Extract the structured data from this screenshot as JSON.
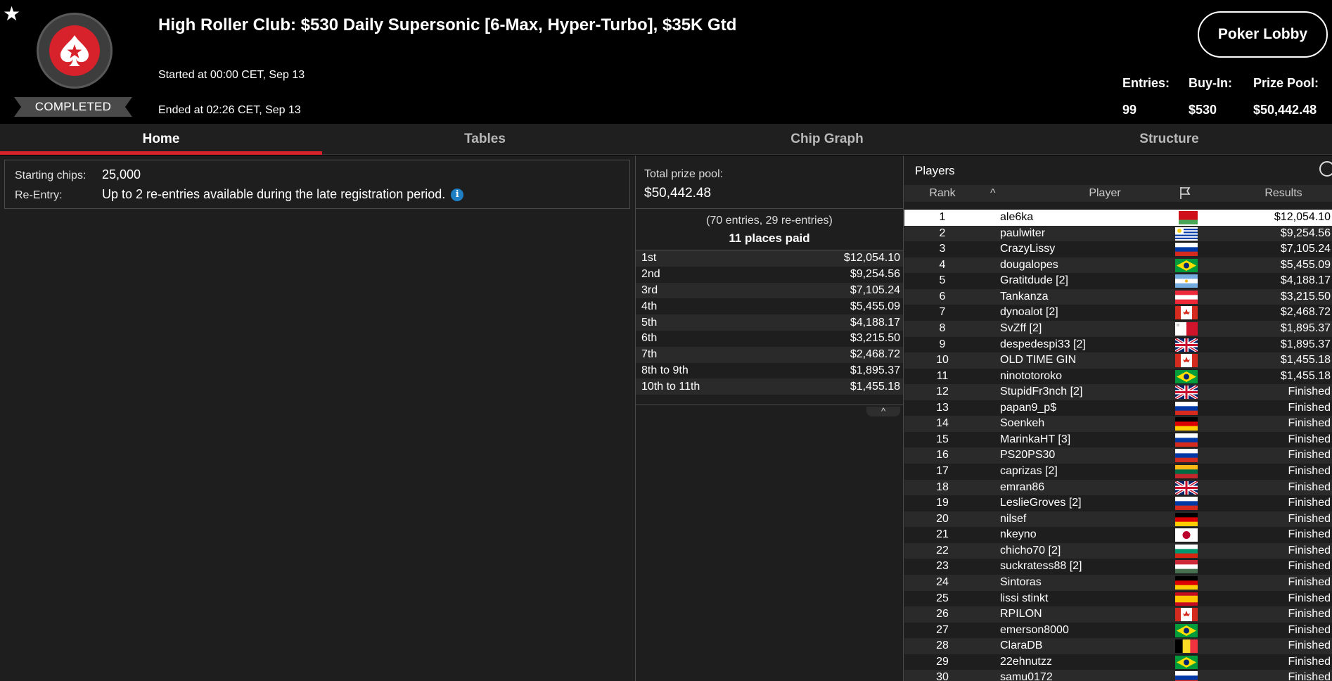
{
  "header": {
    "title": "High Roller Club: $530 Daily Supersonic [6-Max, Hyper-Turbo], $35K Gtd",
    "started": "Started at 00:00 CET, Sep 13",
    "ended": "Ended at 02:26 CET, Sep 13",
    "status": "COMPLETED",
    "lobby_button": "Poker Lobby",
    "stats": {
      "entries_label": "Entries:",
      "entries_value": "99",
      "buyin_label": "Buy-In:",
      "buyin_value": "$530",
      "prizepool_label": "Prize Pool:",
      "prizepool_value": "$50,442.48"
    },
    "icons": {
      "favorite": "star-icon",
      "logo": "pokerstars-spade-logo"
    }
  },
  "tabs": [
    {
      "label": "Home",
      "active": true
    },
    {
      "label": "Tables",
      "active": false
    },
    {
      "label": "Chip Graph",
      "active": false
    },
    {
      "label": "Structure",
      "active": false
    }
  ],
  "info": {
    "starting_chips_label": "Starting chips:",
    "starting_chips_value": "25,000",
    "reentry_label": "Re-Entry:",
    "reentry_value": "Up to 2 re-entries available during the late registration period.",
    "info_icon": "i"
  },
  "prize": {
    "total_label": "Total prize pool:",
    "total_value": "$50,442.48",
    "entries_note": "(70 entries, 29 re-entries)",
    "places_paid": "11 places paid",
    "payouts": [
      {
        "place": "1st",
        "amount": "$12,054.10"
      },
      {
        "place": "2nd",
        "amount": "$9,254.56"
      },
      {
        "place": "3rd",
        "amount": "$7,105.24"
      },
      {
        "place": "4th",
        "amount": "$5,455.09"
      },
      {
        "place": "5th",
        "amount": "$4,188.17"
      },
      {
        "place": "6th",
        "amount": "$3,215.50"
      },
      {
        "place": "7th",
        "amount": "$2,468.72"
      },
      {
        "place": "8th to 9th",
        "amount": "$1,895.37"
      },
      {
        "place": "10th to 11th",
        "amount": "$1,455.18"
      }
    ],
    "collapse_glyph": "^"
  },
  "players": {
    "title": "Players",
    "columns": {
      "rank": "Rank",
      "sort_glyph": "^",
      "player": "Player",
      "results": "Results"
    },
    "rows": [
      {
        "rank": "1",
        "name": "ale6ka",
        "flag": "belarus",
        "result": "$12,054.10",
        "selected": true
      },
      {
        "rank": "2",
        "name": "paulwiter",
        "flag": "uruguay",
        "result": "$9,254.56"
      },
      {
        "rank": "3",
        "name": "CrazyLissy",
        "flag": "russia",
        "result": "$7,105.24"
      },
      {
        "rank": "4",
        "name": "dougalopes",
        "flag": "brazil",
        "result": "$5,455.09"
      },
      {
        "rank": "5",
        "name": "Gratitdude [2]",
        "flag": "argentina",
        "result": "$4,188.17"
      },
      {
        "rank": "6",
        "name": "Tankanza",
        "flag": "austria",
        "result": "$3,215.50"
      },
      {
        "rank": "7",
        "name": "dynoalot [2]",
        "flag": "canada",
        "result": "$2,468.72"
      },
      {
        "rank": "8",
        "name": "SvZff [2]",
        "flag": "malta",
        "result": "$1,895.37"
      },
      {
        "rank": "9",
        "name": "despedespi33 [2]",
        "flag": "uk",
        "result": "$1,895.37"
      },
      {
        "rank": "10",
        "name": "OLD TIME GIN",
        "flag": "canada",
        "result": "$1,455.18"
      },
      {
        "rank": "11",
        "name": "ninototoroko",
        "flag": "brazil",
        "result": "$1,455.18"
      },
      {
        "rank": "12",
        "name": "StupidFr3nch [2]",
        "flag": "uk",
        "result": "Finished"
      },
      {
        "rank": "13",
        "name": "papan9_p$",
        "flag": "russia",
        "result": "Finished"
      },
      {
        "rank": "14",
        "name": "Soenkeh",
        "flag": "germany",
        "result": "Finished"
      },
      {
        "rank": "15",
        "name": "MarinkaHT [3]",
        "flag": "russia",
        "result": "Finished"
      },
      {
        "rank": "16",
        "name": "PS20PS30",
        "flag": "russia",
        "result": "Finished"
      },
      {
        "rank": "17",
        "name": "caprizas [2]",
        "flag": "lithuania",
        "result": "Finished"
      },
      {
        "rank": "18",
        "name": "emran86",
        "flag": "uk",
        "result": "Finished"
      },
      {
        "rank": "19",
        "name": "LeslieGroves [2]",
        "flag": "russia",
        "result": "Finished"
      },
      {
        "rank": "20",
        "name": "nilsef",
        "flag": "germany",
        "result": "Finished"
      },
      {
        "rank": "21",
        "name": "nkeyno",
        "flag": "japan",
        "result": "Finished"
      },
      {
        "rank": "22",
        "name": "chicho70 [2]",
        "flag": "bulgaria",
        "result": "Finished"
      },
      {
        "rank": "23",
        "name": "suckratess88 [2]",
        "flag": "hungary",
        "result": "Finished"
      },
      {
        "rank": "24",
        "name": "Sintoras",
        "flag": "germany",
        "result": "Finished"
      },
      {
        "rank": "25",
        "name": "lissi stinkt",
        "flag": "spain",
        "result": "Finished"
      },
      {
        "rank": "26",
        "name": "RPILON",
        "flag": "canada",
        "result": "Finished"
      },
      {
        "rank": "27",
        "name": "emerson8000",
        "flag": "brazil",
        "result": "Finished"
      },
      {
        "rank": "28",
        "name": "ClaraDB",
        "flag": "belgium",
        "result": "Finished"
      },
      {
        "rank": "29",
        "name": "22ehnutzz",
        "flag": "brazil",
        "result": "Finished"
      },
      {
        "rank": "30",
        "name": "samu0172",
        "flag": "russia",
        "result": "Finished"
      }
    ]
  },
  "colors": {
    "accent": "#d7222b",
    "background": "#000000",
    "panel": "#1e1e1e",
    "row_alt": "#2a2a2a",
    "info_icon": "#1e7fc4"
  }
}
